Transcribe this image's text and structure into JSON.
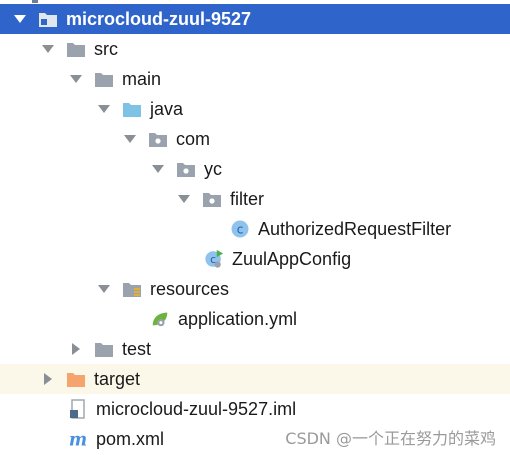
{
  "tree": {
    "items": [
      {
        "label": "microcloud-zuul-9527"
      },
      {
        "label": "src"
      },
      {
        "label": "main"
      },
      {
        "label": "java"
      },
      {
        "label": "com"
      },
      {
        "label": "yc"
      },
      {
        "label": "filter"
      },
      {
        "label": "AuthorizedRequestFilter"
      },
      {
        "label": "ZuulAppConfig"
      },
      {
        "label": "resources"
      },
      {
        "label": "application.yml"
      },
      {
        "label": "test"
      },
      {
        "label": "target"
      },
      {
        "label": "microcloud-zuul-9527.iml"
      },
      {
        "label": "pom.xml"
      }
    ]
  },
  "watermark": "CSDN @一个正在努力的菜鸡",
  "colors": {
    "selection": "#2f65ca",
    "folder": "#9aa3ad",
    "source_folder": "#7ec3e6",
    "excluded_folder": "#f4a46c",
    "class_icon": "#3d8fd6",
    "maven_icon": "#4a90e2"
  }
}
